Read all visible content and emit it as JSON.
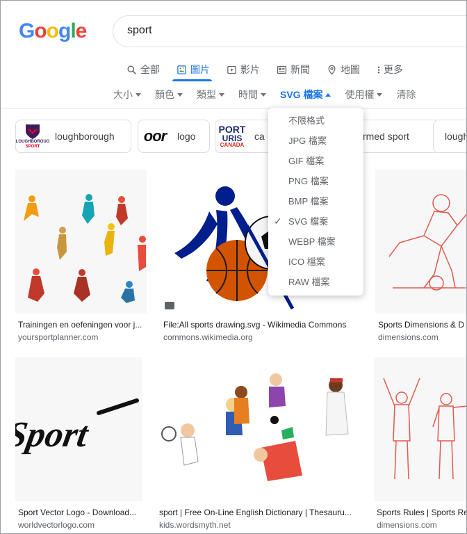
{
  "logo": {
    "letters": [
      "G",
      "o",
      "o",
      "g",
      "l",
      "e"
    ],
    "colors": [
      "#4285F4",
      "#EA4335",
      "#FBBC05",
      "#4285F4",
      "#34A853",
      "#EA4335"
    ]
  },
  "search": {
    "query": "sport"
  },
  "tabs": [
    {
      "label": "全部",
      "icon": "search-icon"
    },
    {
      "label": "圖片",
      "icon": "image-icon",
      "active": true
    },
    {
      "label": "影片",
      "icon": "video-icon"
    },
    {
      "label": "新聞",
      "icon": "news-icon"
    },
    {
      "label": "地圖",
      "icon": "map-pin-icon"
    },
    {
      "label": "更多",
      "icon": "more-vert-icon"
    }
  ],
  "filters": [
    {
      "label": "大小"
    },
    {
      "label": "顏色"
    },
    {
      "label": "類型"
    },
    {
      "label": "時間"
    },
    {
      "label": "SVG 檔案",
      "active": true
    },
    {
      "label": "使用權"
    },
    {
      "label": "清除"
    }
  ],
  "chips": [
    {
      "label": "loughborough",
      "thumb_text": "LOUGHBOROUG SPORT"
    },
    {
      "label": "logo",
      "thumb_text": "oor"
    },
    {
      "label": "ca",
      "thumb_text": "PORT URIS CANADA"
    },
    {
      "label": "rmed sport",
      "thumb_text": ""
    },
    {
      "label": "lough",
      "thumb_text": ""
    }
  ],
  "results": [
    {
      "title": "Trainingen en oefeningen voor j...",
      "source": "yoursportplanner.com"
    },
    {
      "title": "File:All sports drawing.svg - Wikimedia Commons",
      "source": "commons.wikimedia.org"
    },
    {
      "title": "Sports Dimensions & D",
      "source": "dimensions.com"
    },
    {
      "title": "Sport Vector Logo - Download...",
      "source": "worldvectorlogo.com",
      "image_text": "Sport"
    },
    {
      "title": "sport | Free On-Line English Dictionary | Thesauru...",
      "source": "kids.wordsmyth.net"
    },
    {
      "title": "Sports Rules | Sports Re",
      "source": "dimensions.com"
    }
  ],
  "dropdown": {
    "items": [
      {
        "label": "不限格式"
      },
      {
        "label": "JPG 檔案"
      },
      {
        "label": "GIF 檔案"
      },
      {
        "label": "PNG 檔案"
      },
      {
        "label": "BMP 檔案"
      },
      {
        "label": "SVG 檔案",
        "checked": true
      },
      {
        "label": "WEBP 檔案"
      },
      {
        "label": "ICO 檔案"
      },
      {
        "label": "RAW 檔案"
      }
    ]
  },
  "colors": {
    "accent": "#1a73e8",
    "muted": "#70757a",
    "chip_border": "#dadce0"
  }
}
